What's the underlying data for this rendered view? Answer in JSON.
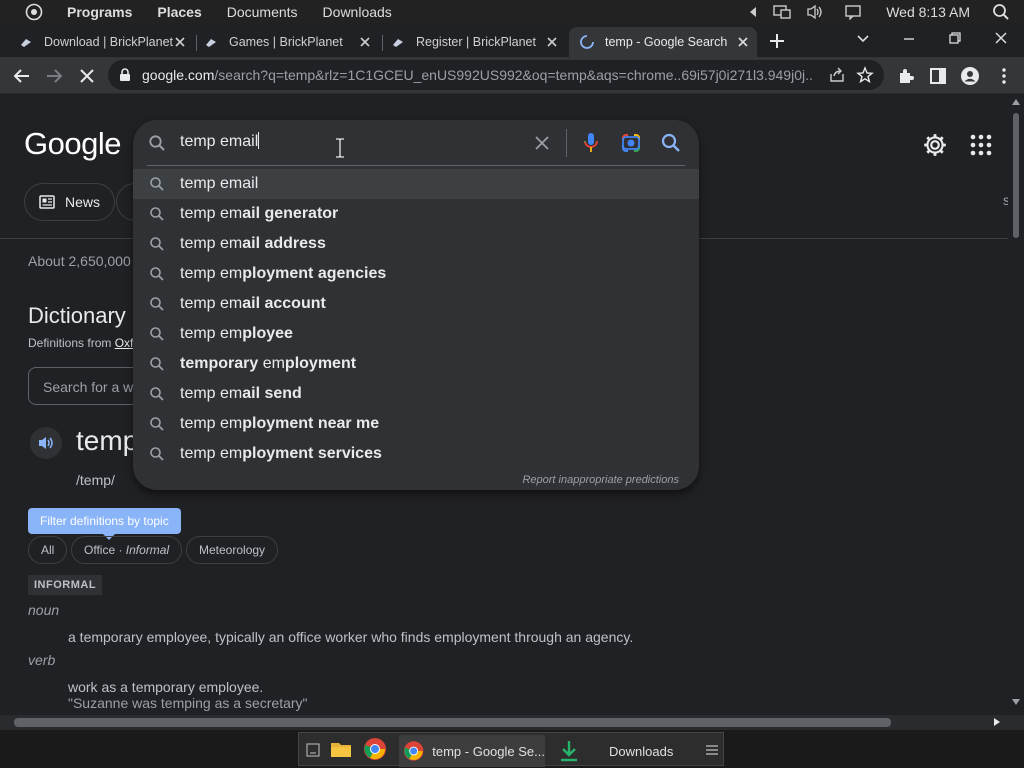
{
  "os_panel": {
    "menu": [
      "Programs",
      "Places",
      "Documents",
      "Downloads"
    ],
    "clock": "Wed  8:13 AM"
  },
  "tabs": [
    {
      "label": "Download | BrickPlanet",
      "icon": "brickplanet-favicon"
    },
    {
      "label": "Games | BrickPlanet",
      "icon": "brickplanet-favicon"
    },
    {
      "label": "Register | BrickPlanet",
      "icon": "brickplanet-favicon"
    },
    {
      "label": "temp - Google Search",
      "icon": "loading-spinner",
      "active": true
    }
  ],
  "toolbar": {
    "url_host": "google.com",
    "url_rest": "/search?q=temp&rlz=1C1GCEU_enUS992US992&oq=temp&aqs=chrome..69i57j0i271l3.949j0j..."
  },
  "search": {
    "query": "temp email",
    "suggestions": [
      {
        "prefix": "temp em",
        "plain": "ail",
        "bold": "",
        "highlighted": true,
        "plain_full": true
      },
      {
        "prefix": "temp em",
        "plain": "",
        "bold": "ail generator"
      },
      {
        "prefix": "temp em",
        "plain": "",
        "bold": "ail address"
      },
      {
        "prefix": "temp em",
        "plain": "",
        "bold": "ployment agencies"
      },
      {
        "prefix": "temp em",
        "plain": "",
        "bold": "ail account"
      },
      {
        "prefix": "temp em",
        "plain": "",
        "bold": "ployee"
      },
      {
        "prefix": "",
        "plain": "",
        "bold": "temporary",
        "suffix_plain": " em",
        "suffix_bold": "ployment"
      },
      {
        "prefix": "temp em",
        "plain": "",
        "bold": "ail send"
      },
      {
        "prefix": "temp em",
        "plain": "",
        "bold": "ployment near me"
      },
      {
        "prefix": "temp em",
        "plain": "",
        "bold": "ployment services"
      }
    ],
    "report_label": "Report inappropriate predictions"
  },
  "page": {
    "logo": "Google",
    "news_chip": "News",
    "stats": "About 2,650,000",
    "dictionary_title": "Dictionary",
    "dict_source_prefix": "Definitions from ",
    "dict_source_link": "Oxf",
    "dict_search_placeholder": "Search for a w",
    "word": "temp",
    "phonetic": "/temp/",
    "filter_button": "Filter definitions by topic",
    "topics": [
      {
        "label": "All"
      },
      {
        "label": "Office",
        "sep": " · ",
        "sub": "Informal"
      },
      {
        "label": "Meteorology"
      }
    ],
    "register_label": "INFORMAL",
    "pos_noun": "noun",
    "def_noun": "a temporary employee, typically an office worker who finds employment through an agency.",
    "pos_verb": "verb",
    "def_verb": "work as a temporary employee.",
    "example_verb": "\"Suzanne was temping as a secretary\""
  },
  "taskbar": {
    "active_label": "temp - Google Se...",
    "downloads_label": "Downloads"
  },
  "colors": {
    "page_bg": "#202124",
    "toolbar_bg": "#35363a",
    "suggest_bg": "#303134",
    "accent_blue": "#8ab4f8"
  }
}
